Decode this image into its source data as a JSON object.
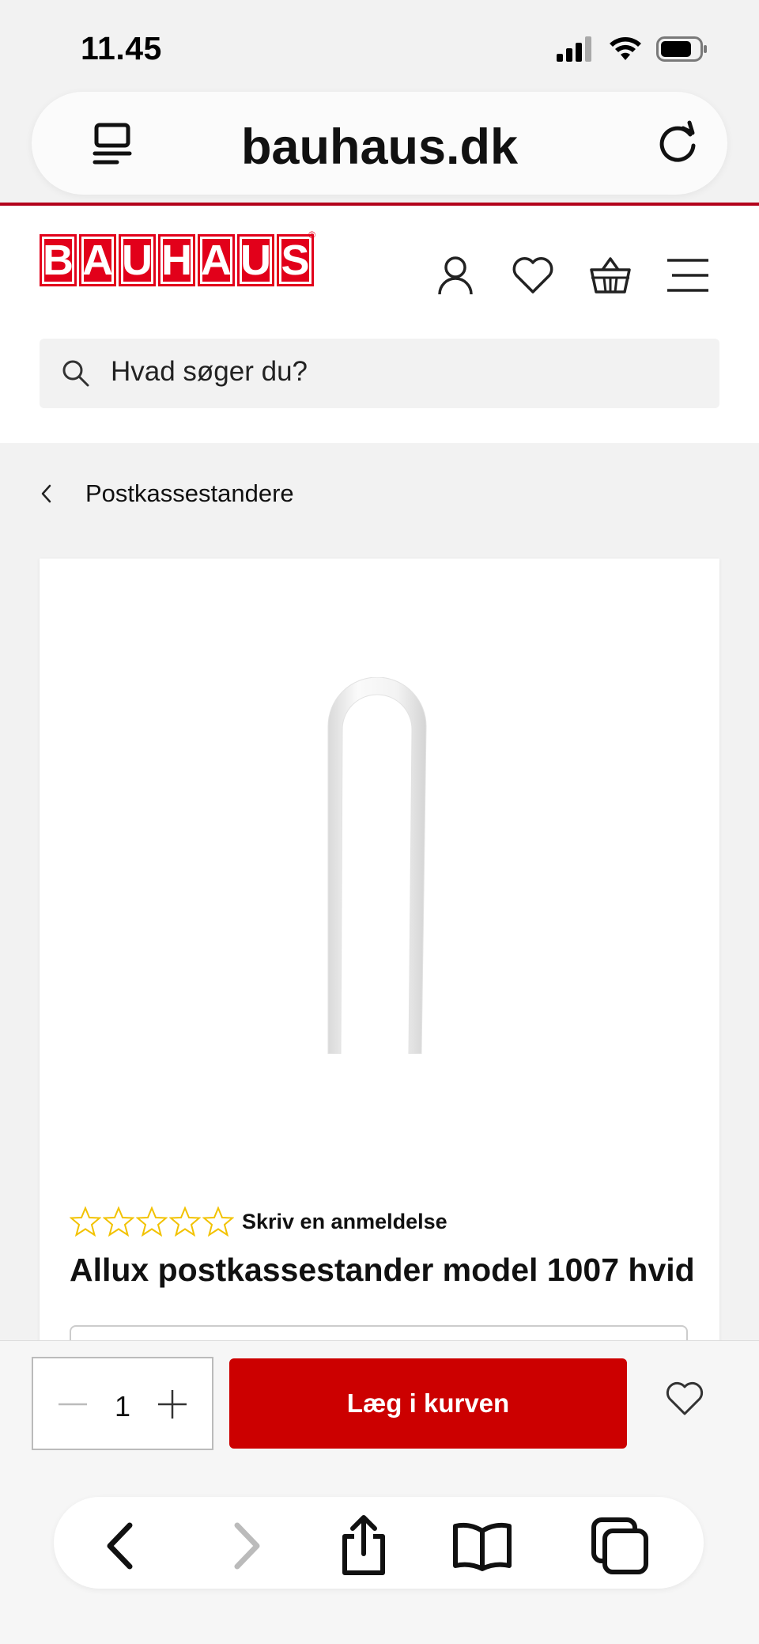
{
  "status": {
    "time": "11.45"
  },
  "browser": {
    "url": "bauhaus.dk"
  },
  "header": {
    "logo_letters": [
      "B",
      "A",
      "U",
      "H",
      "A",
      "U",
      "S"
    ],
    "logo_reg": "®",
    "search_placeholder": "Hvad søger du?"
  },
  "breadcrumb": {
    "label": "Postkassestandere"
  },
  "product": {
    "review_link": "Skriv en anmeldelse",
    "rating_stars": 0,
    "title": "Allux postkassestander model 1007 hvid"
  },
  "buy": {
    "quantity": "1",
    "add_to_cart": "Læg i kurven"
  },
  "icons": {
    "tabs_menu": "tabs-menu-icon",
    "reload": "reload-icon",
    "account": "account-icon",
    "wishlist": "heart-icon",
    "basket": "basket-icon",
    "menu": "hamburger-menu-icon",
    "search": "search-icon",
    "back": "chevron-left-icon",
    "share": "share-icon",
    "bookmarks": "book-icon",
    "tabs": "tabs-icon"
  },
  "colors": {
    "brand_red": "#e2001a",
    "button_red": "#cc0000",
    "divider_red": "#b3001b"
  }
}
